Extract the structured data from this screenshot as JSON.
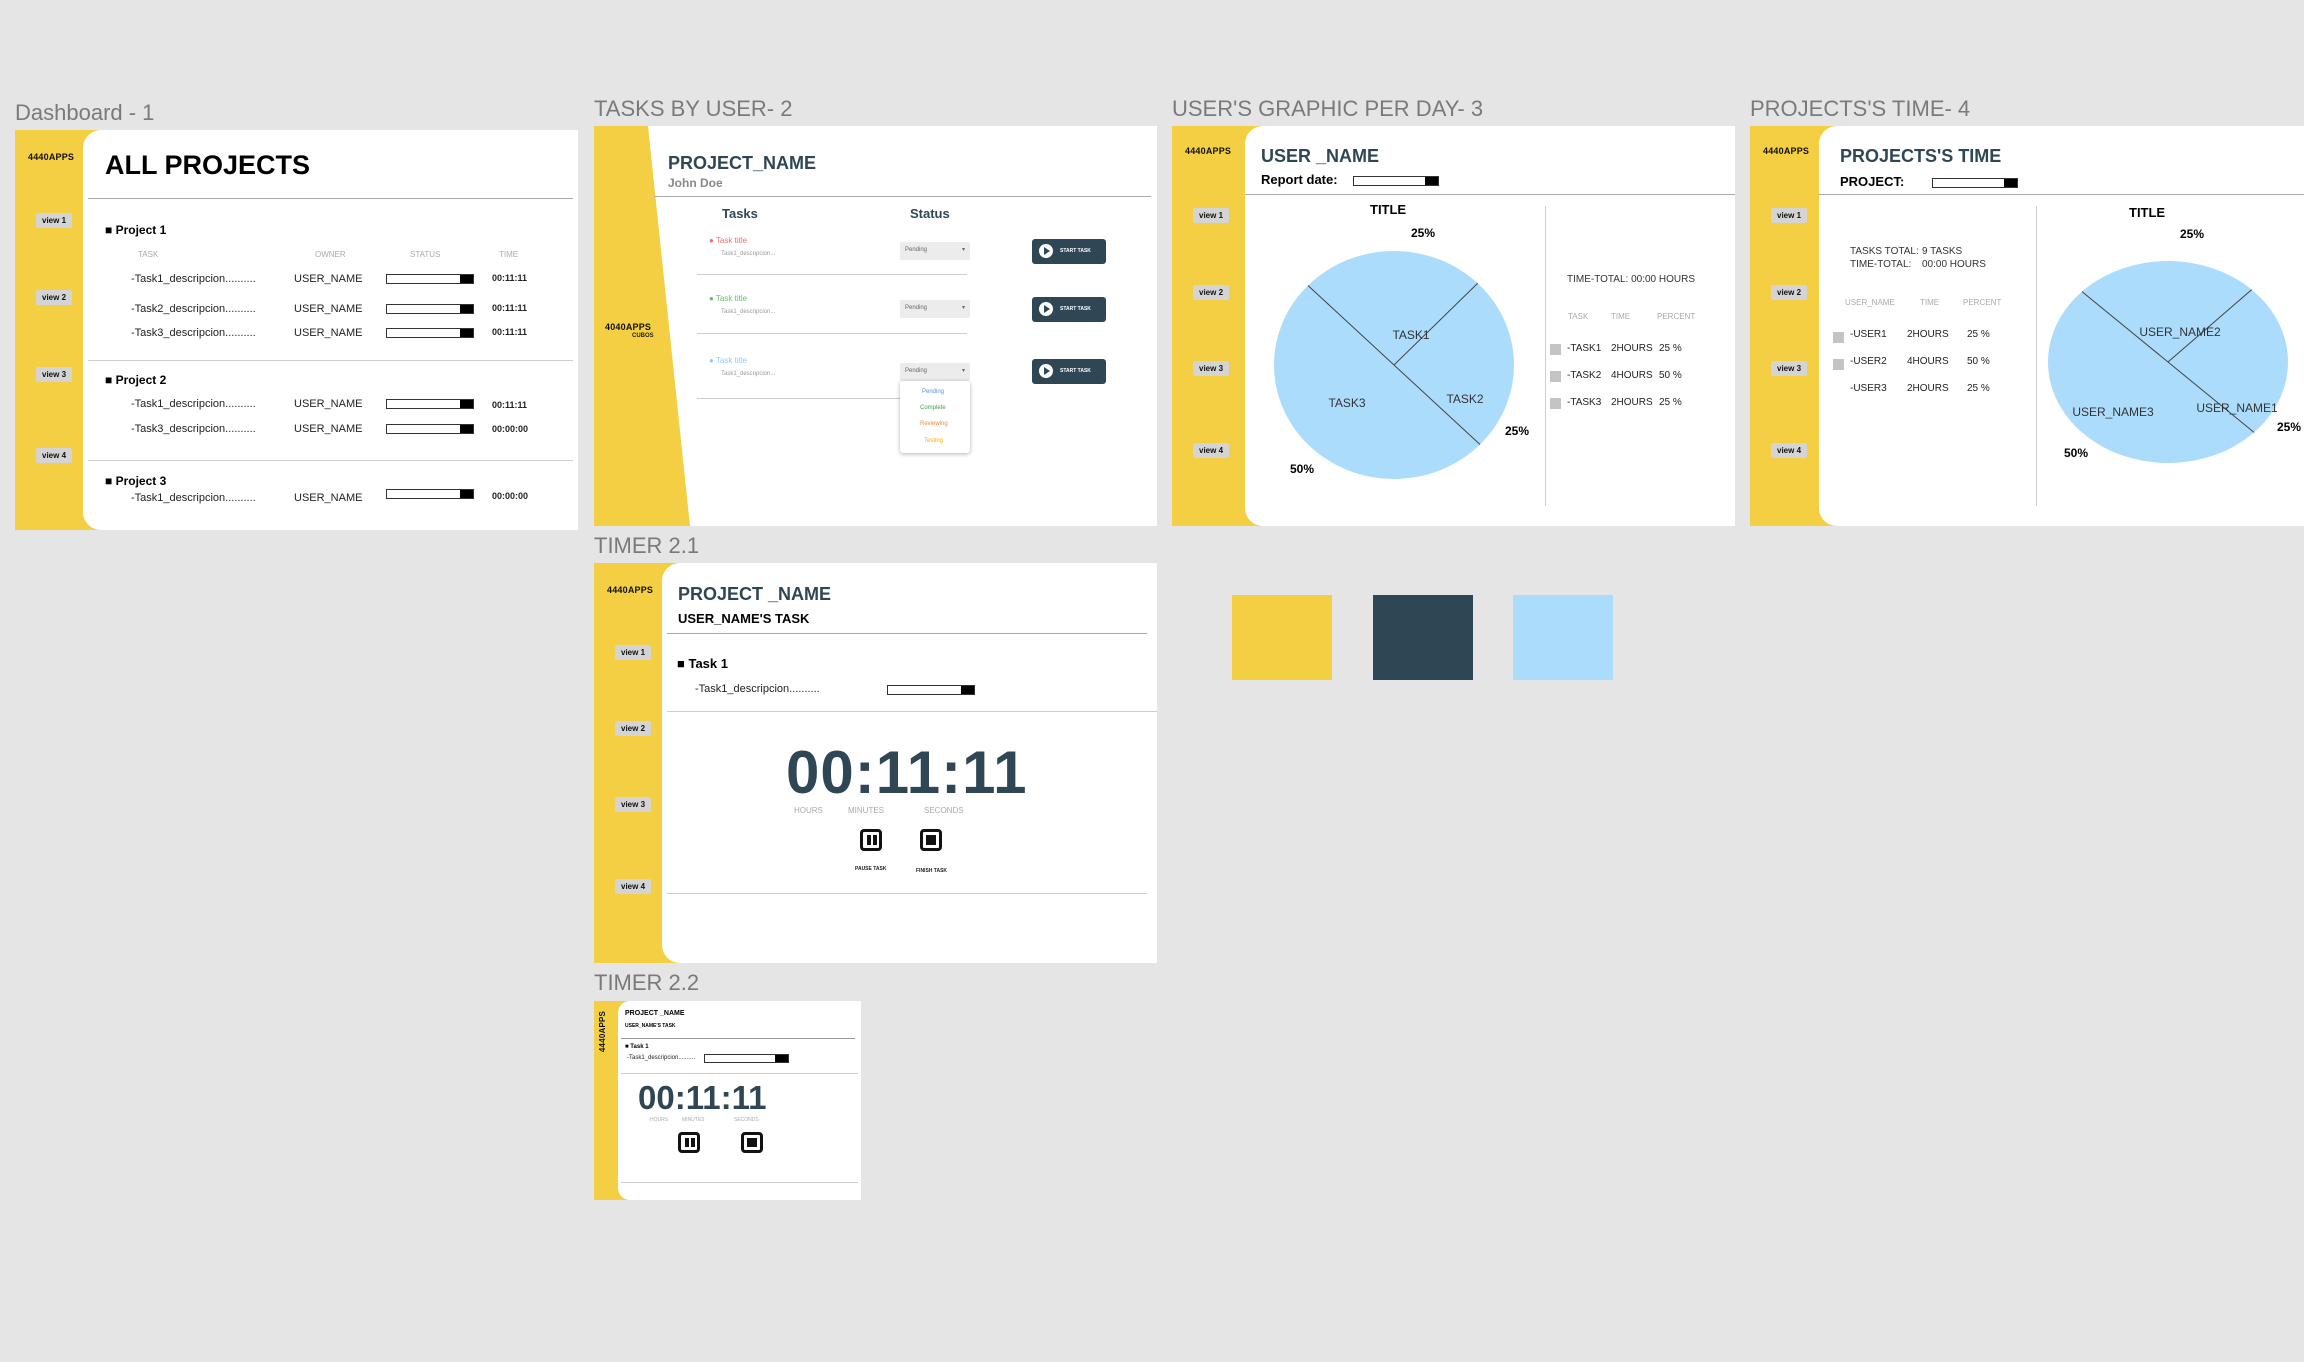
{
  "labels": {
    "dashboard": "Dashboard - 1",
    "tasks_by_user": "TASKS BY USER- 2",
    "users_graphic": "USER'S GRAPHIC PER DAY- 3",
    "projects_time": "PROJECTS'S TIME- 4",
    "timer21": "TIMER 2.1",
    "timer22": "TIMER 2.2"
  },
  "brand": "4440APPS",
  "brand_alt": "4040APPS",
  "brand_sub": "CUBOS",
  "nav": [
    "view 1",
    "view 2",
    "view 3",
    "view 4"
  ],
  "colors": {
    "yellow": "#f4cf43",
    "navy": "#2f4655",
    "lightblue": "#acdcfb"
  },
  "dashboard": {
    "title": "ALL PROJECTS",
    "headers": [
      "TASK",
      "OWNER",
      "STATUS",
      "TIME"
    ],
    "projects": [
      {
        "name": "Project 1",
        "rows": [
          {
            "task": "-Task1_descripcion..........",
            "owner": "USER_NAME",
            "time": "00:11:11"
          },
          {
            "task": "-Task2_descripcion..........",
            "owner": "USER_NAME",
            "time": "00:11:11"
          },
          {
            "task": "-Task3_descripcion..........",
            "owner": "USER_NAME",
            "time": "00:11:11"
          }
        ]
      },
      {
        "name": "Project 2",
        "rows": [
          {
            "task": "-Task1_descripcion..........",
            "owner": "USER_NAME",
            "time": "00:11:11"
          },
          {
            "task": "-Task3_descripcion..........",
            "owner": "USER_NAME",
            "time": "00:00:00"
          }
        ]
      },
      {
        "name": "Project 3",
        "rows": [
          {
            "task": "-Task1_descripcion..........",
            "owner": "USER_NAME",
            "time": "00:00:00"
          }
        ]
      }
    ]
  },
  "tasks": {
    "project": "PROJECT_NAME",
    "user": "John Doe",
    "col_tasks": "Tasks",
    "col_status": "Status",
    "items": [
      {
        "title": "Task title",
        "desc": "Task1_descripcion...",
        "status": "Pending",
        "color": "#e57373"
      },
      {
        "title": "Task title",
        "desc": "Task1_descripcion...",
        "status": "Pending",
        "color": "#66bb6a"
      },
      {
        "title": "Task title",
        "desc": "Task1_descripcion...",
        "status": "Pending",
        "color": "#90caf9"
      }
    ],
    "start_label": "START TASK",
    "dropdown": [
      {
        "label": "Pending",
        "color": "#5c8fd6"
      },
      {
        "label": "Complete",
        "color": "#43a047"
      },
      {
        "label": "Reviewing",
        "color": "#ef8a3c"
      },
      {
        "label": "Testing",
        "color": "#f4b400"
      }
    ]
  },
  "graphic": {
    "user": "USER _NAME",
    "report_label": "Report date:",
    "chart_title": "TITLE",
    "time_total": "TIME-TOTAL: 00:00 HOURS",
    "headers": [
      "TASK",
      "TIME",
      "PERCENT"
    ],
    "rows": [
      {
        "task": "-TASK1",
        "time": "2HOURS",
        "percent": "25 %"
      },
      {
        "task": "-TASK2",
        "time": "4HOURS",
        "percent": "50 %"
      },
      {
        "task": "-TASK3",
        "time": "2HOURS",
        "percent": "25 %"
      }
    ],
    "pct_labels": [
      "25%",
      "25%",
      "50%"
    ]
  },
  "projtime": {
    "title": "PROJECTS'S TIME",
    "project_label": "PROJECT:",
    "chart_title": "TITLE",
    "tasks_total_label": "TASKS TOTAL:",
    "tasks_total_value": "9 TASKS",
    "time_total_label": "TIME-TOTAL:",
    "time_total_value": "00:00 HOURS",
    "headers": [
      "USER_NAME",
      "TIME",
      "PERCENT"
    ],
    "rows": [
      {
        "user": "-USER1",
        "time": "2HOURS",
        "percent": "25 %"
      },
      {
        "user": "-USER2",
        "time": "4HOURS",
        "percent": "50 %"
      },
      {
        "user": "-USER3",
        "time": "2HOURS",
        "percent": "25 %"
      }
    ],
    "pct_labels": [
      "25%",
      "25%",
      "50%"
    ]
  },
  "timer": {
    "project": "PROJECT _NAME",
    "user_task": "USER_NAME'S TASK",
    "task": "Task 1",
    "desc": "-Task1_descripcion..........",
    "clock": "00:11:11",
    "units": [
      "HOURS",
      "MINUTES",
      "SECONDS"
    ],
    "pause_label": "PAUSE TASK",
    "finish_label": "FINISH TASK"
  },
  "chart_data": [
    {
      "type": "pie",
      "title": "TITLE",
      "categories": [
        "TASK1",
        "TASK2",
        "TASK3"
      ],
      "values": [
        25,
        25,
        50
      ]
    },
    {
      "type": "pie",
      "title": "TITLE",
      "categories": [
        "USER_NAME2",
        "USER_NAME1",
        "USER_NAME3"
      ],
      "values": [
        25,
        25,
        50
      ]
    }
  ]
}
